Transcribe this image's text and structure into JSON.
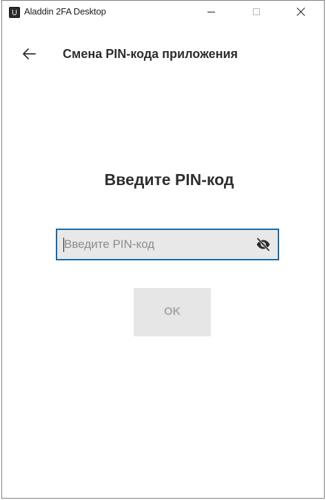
{
  "window": {
    "title": "Aladdin 2FA Desktop"
  },
  "header": {
    "title": "Смена PIN-кода приложения"
  },
  "main": {
    "prompt": "Введите PIN-код",
    "pin_field": {
      "value": "",
      "placeholder": "Введите PIN-код"
    },
    "ok_label": "OK"
  },
  "icons": {
    "app": "app-logo-icon",
    "back": "arrow-left-icon",
    "visibility": "eye-off-icon",
    "minimize": "minimize-icon",
    "maximize": "maximize-icon",
    "close": "close-icon"
  },
  "colors": {
    "focus_border": "#1565a8",
    "field_background": "#e8e8e8",
    "button_disabled_background": "#e6e6e6",
    "button_disabled_text": "#a8a8a8"
  }
}
